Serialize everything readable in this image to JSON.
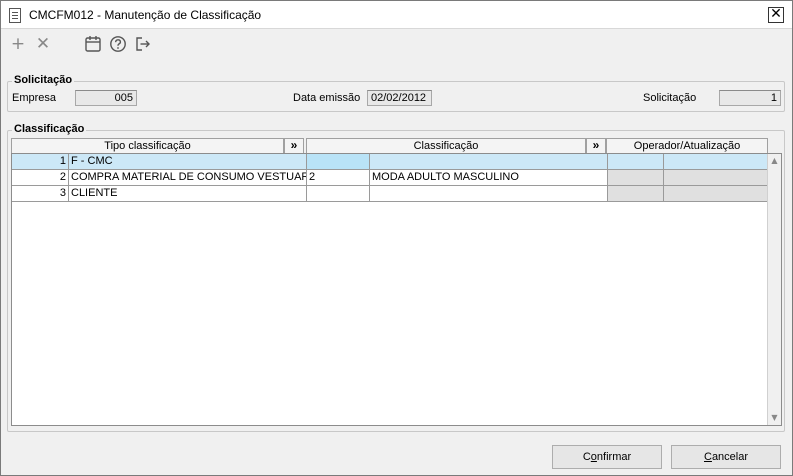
{
  "window": {
    "title": "CMCFM012 - Manutenção de Classificação",
    "close_label": "✕"
  },
  "toolbar": {
    "add_icon": "plus-icon",
    "remove_icon": "close-icon",
    "calendar_icon": "calendar-icon",
    "help_icon": "help-icon",
    "exit_icon": "exit-icon"
  },
  "solicitacao": {
    "group_label": "Solicitação",
    "empresa_label": "Empresa",
    "empresa_value": "005",
    "data_label": "Data emissão",
    "data_value": "02/02/2012",
    "solicitacao_label": "Solicitação",
    "solicitacao_value": "1"
  },
  "classificacao": {
    "group_label": "Classificação",
    "columns": {
      "tipo": "Tipo classificação",
      "classificacao": "Classificação",
      "operador": "Operador/Atualização",
      "expand": "»"
    },
    "rows": [
      {
        "num": "1",
        "tipo": "F - CMC",
        "code": "",
        "desc": "",
        "op": "",
        "upd": ""
      },
      {
        "num": "2",
        "tipo": "COMPRA MATERIAL DE CONSUMO VESTUARIO",
        "code": "2",
        "desc": "MODA ADULTO MASCULINO",
        "op": "",
        "upd": ""
      },
      {
        "num": "3",
        "tipo": "CLIENTE",
        "code": "",
        "desc": "",
        "op": "",
        "upd": ""
      }
    ]
  },
  "buttons": {
    "confirm_pre": "C",
    "confirm_u": "o",
    "confirm_post": "nfirmar",
    "cancel_pre": "",
    "cancel_u": "C",
    "cancel_post": "ancelar"
  },
  "scroll": {
    "up": "▲",
    "down": "▼"
  }
}
